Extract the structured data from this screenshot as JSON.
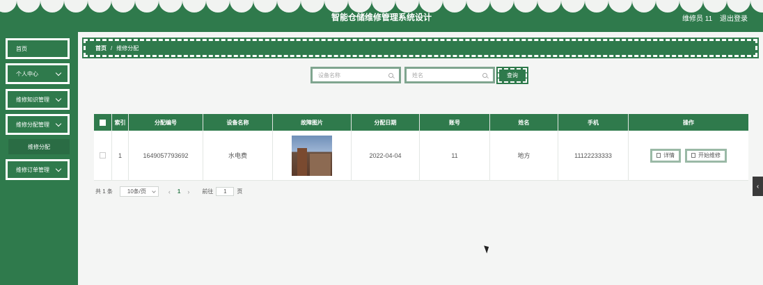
{
  "header": {
    "title": "智能仓储维修管理系统设计",
    "user": "维修员 11",
    "logout": "退出登录"
  },
  "sidebar": {
    "items": [
      {
        "label": "首页"
      },
      {
        "label": "个人中心"
      },
      {
        "label": "维修知识管理"
      },
      {
        "label": "维修分配管理"
      },
      {
        "label": "维修订单管理"
      }
    ],
    "submenu_label": "维修分配"
  },
  "breadcrumb": {
    "home": "首页",
    "separator": "/",
    "current": "维修分配"
  },
  "search": {
    "device_placeholder": "设备名称",
    "name_placeholder": "姓名",
    "query_label": "查询"
  },
  "table": {
    "headers": [
      "索引",
      "分配编号",
      "设备名称",
      "故障图片",
      "分配日期",
      "账号",
      "姓名",
      "手机",
      "操作"
    ],
    "rows": [
      {
        "index": "1",
        "assign_no": "1649057793692",
        "device": "水电费",
        "date": "2022-04-04",
        "account": "11",
        "name": "地方",
        "phone": "11122233333"
      }
    ],
    "actions": {
      "detail": "详情",
      "start": "开始维修"
    }
  },
  "pagination": {
    "total": "共 1 条",
    "page_size": "10条/页",
    "current_page": "1",
    "goto_label": "前往",
    "goto_value": "1",
    "page_suffix": "页"
  },
  "colors": {
    "primary": "#2f7a4c",
    "background": "#f4f5f4"
  },
  "icons": {
    "collapse_tab": "chevron-left-icon"
  }
}
